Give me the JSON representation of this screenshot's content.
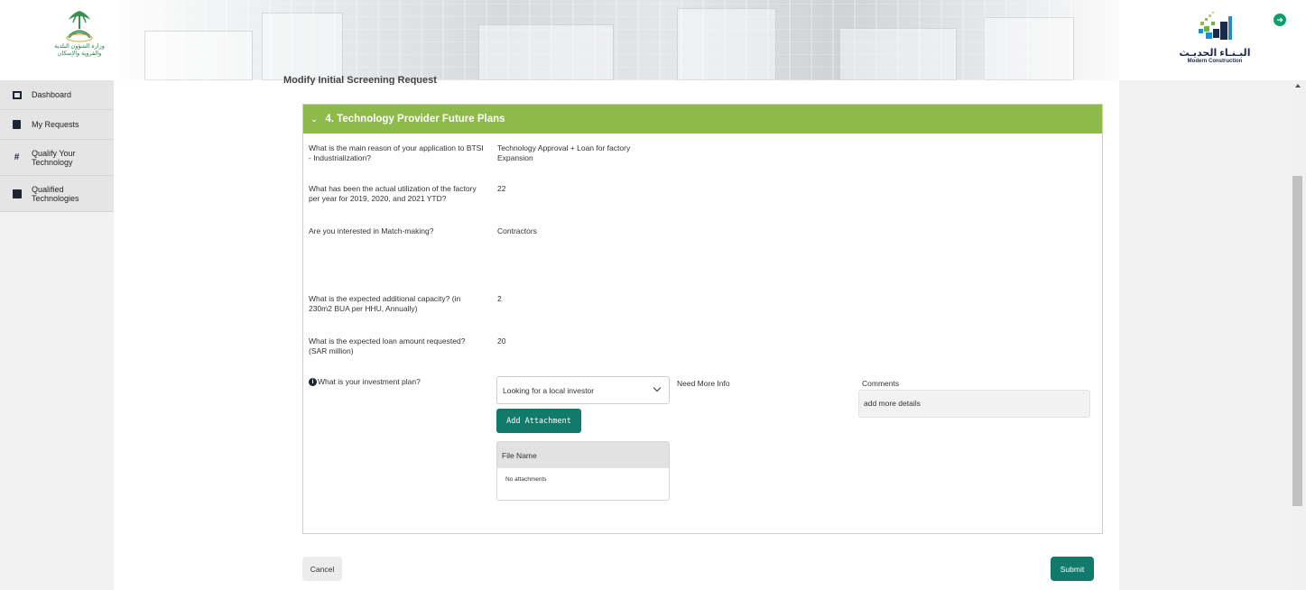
{
  "header": {
    "left_logo_text": [
      "وزارة الشؤون البلدية",
      "والقروية والإسكان"
    ],
    "right_logo_text_ar": "البـنـاء الحديـث",
    "right_logo_text_en": "Modern Construction",
    "logout_icon": "logout-icon"
  },
  "sidebar": {
    "items": [
      {
        "label": "Dashboard",
        "icon": "dashboard-icon"
      },
      {
        "label": "My Requests",
        "icon": "clipboard-icon"
      },
      {
        "label": "Qualify Your Technology",
        "icon": "hashtag-icon"
      },
      {
        "label": "Qualified Technologies",
        "icon": "box-icon"
      }
    ]
  },
  "main": {
    "page_title": "Modify Initial Screening Request",
    "section": {
      "title": "4. Technology Provider Future Plans",
      "questions": [
        {
          "q": "What is the main reason of your application to BTSI - Industrialization?",
          "a": "Technology Approval + Loan for factory Expansion"
        },
        {
          "q": "What has been the actual utilization of the factory per year for 2019, 2020, and 2021 YTD?",
          "a": "22"
        },
        {
          "q": "Are you interested in Match-making?",
          "a": "Contractors"
        },
        {
          "q": "What is the expected additional capacity? (in 230m2 BUA per HHU, Annually)",
          "a": "2"
        },
        {
          "q": "What is the expected loan amount requested? (SAR million)",
          "a": "20"
        }
      ],
      "investment": {
        "question": "What is your investment plan?",
        "selected": "Looking for a local investor",
        "add_attachment": "Add Attachment",
        "file_table_header": "File Name",
        "file_table_empty": "No attachments",
        "need_more_info": "Need More Info",
        "comments_label": "Comments",
        "comments_value": "add more details"
      }
    },
    "cancel": "Cancel",
    "submit": "Submit"
  },
  "colors": {
    "section_header": "#8dba4a",
    "primary_button": "#127a6a",
    "logout": "#0f9d6b"
  }
}
